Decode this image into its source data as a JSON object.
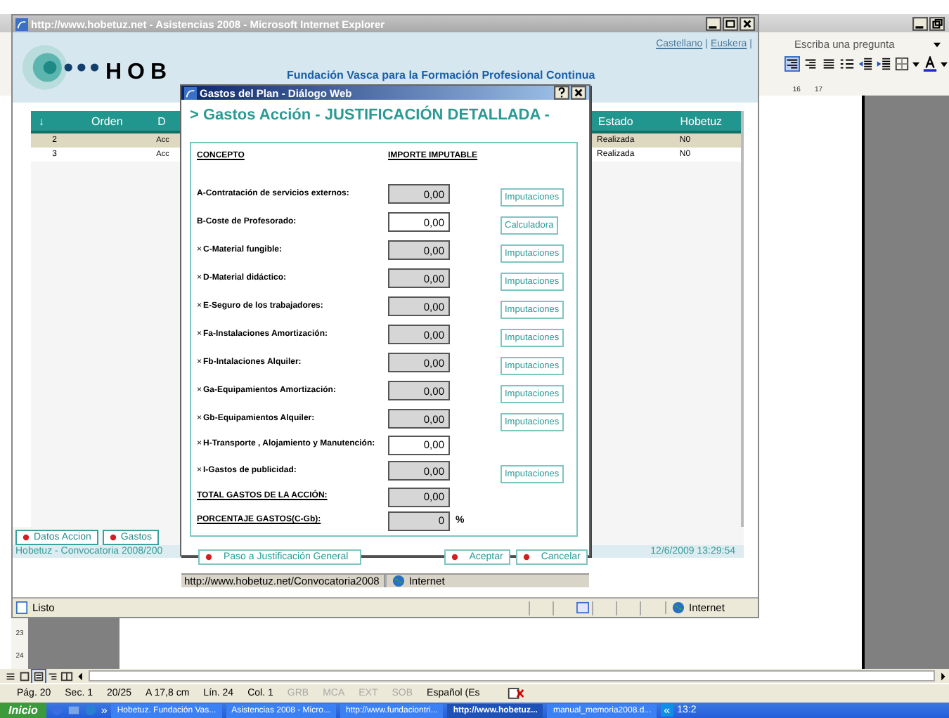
{
  "word": {
    "help_placeholder": "Escriba una pregunta",
    "ruler_labels": [
      "16",
      "17"
    ],
    "vertical_ruler_labels": [
      "23",
      "24"
    ],
    "status_bar": [
      {
        "text": "Pág. 20",
        "disabled": false
      },
      {
        "text": "Sec. 1",
        "disabled": false
      },
      {
        "text": "20/25",
        "disabled": false
      },
      {
        "text": "A 17,8 cm",
        "disabled": false
      },
      {
        "text": "Lín. 24",
        "disabled": false
      },
      {
        "text": "Col. 1",
        "disabled": false
      },
      {
        "text": "GRB",
        "disabled": true
      },
      {
        "text": "MCA",
        "disabled": true
      },
      {
        "text": "EXT",
        "disabled": true
      },
      {
        "text": "SOB",
        "disabled": true
      },
      {
        "text": "Español (Es",
        "disabled": false
      }
    ]
  },
  "browser": {
    "title": "http://www.hobetuz.net - Asistencias 2008 - Microsoft Internet Explorer",
    "language_links": [
      "Castellano",
      "Euskera"
    ],
    "link_separator": "|",
    "logo_text": "HOB",
    "tagline": "Fundación Vasca para la Formación Profesional Continua",
    "table": {
      "sort_marker": "↓",
      "columns": [
        "Orden",
        "D",
        "Estado",
        "Hobetuz"
      ],
      "rows": [
        {
          "cells": [
            "2",
            "Acc",
            "Realizada",
            "N0"
          ],
          "selected": true
        },
        {
          "cells": [
            "3",
            "Acc",
            "Realizada",
            "N0"
          ],
          "selected": false
        }
      ]
    },
    "bottom_tabs": [
      "Datos Accion",
      "Gastos"
    ],
    "footer_left": "Hobetuz - Convocatoria 2008/200",
    "footer_right": "12/6/2009 13:29:54",
    "status_text": "Listo",
    "zone": "Internet"
  },
  "dialog": {
    "title": "Gastos del Plan - Diálogo Web",
    "heading": "> Gastos Acción - JUSTIFICACIÓN DETALLADA -",
    "column_concept": "CONCEPTO",
    "column_amount": "IMPORTE IMPUTABLE",
    "rows": [
      {
        "kind": "item",
        "label": "A-Contratación de servicios externos:",
        "value": "0,00",
        "editable": false,
        "action": "Imputaciones"
      },
      {
        "kind": "item",
        "label": "B-Coste de Profesorado:",
        "value": "0,00",
        "editable": true,
        "action": "Calculadora"
      },
      {
        "kind": "item",
        "marker": "×",
        "label": "C-Material fungible:",
        "value": "0,00",
        "editable": false,
        "action": "Imputaciones"
      },
      {
        "kind": "item",
        "marker": "×",
        "label": "D-Material didáctico:",
        "value": "0,00",
        "editable": false,
        "action": "Imputaciones"
      },
      {
        "kind": "item",
        "marker": "×",
        "label": "E-Seguro de los trabajadores:",
        "value": "0,00",
        "editable": false,
        "action": "Imputaciones"
      },
      {
        "kind": "item",
        "marker": "×",
        "label": "Fa-Instalaciones Amortización:",
        "value": "0,00",
        "editable": false,
        "action": "Imputaciones"
      },
      {
        "kind": "item",
        "marker": "×",
        "label": "Fb-Intalaciones Alquiler:",
        "value": "0,00",
        "editable": false,
        "action": "Imputaciones"
      },
      {
        "kind": "item",
        "marker": "×",
        "label": "Ga-Equipamientos Amortización:",
        "value": "0,00",
        "editable": false,
        "action": "Imputaciones"
      },
      {
        "kind": "item",
        "marker": "×",
        "label": "Gb-Equipamientos Alquiler:",
        "value": "0,00",
        "editable": false,
        "action": "Imputaciones"
      },
      {
        "kind": "item",
        "marker": "×",
        "label": "H-Transporte , Alojamiento y Manutención:",
        "value": "0,00",
        "editable": true
      },
      {
        "kind": "item",
        "marker": "×",
        "label": "I-Gastos de publicidad:",
        "value": "0,00",
        "editable": false,
        "action": "Imputaciones"
      },
      {
        "kind": "total",
        "label": "TOTAL GASTOS DE LA ACCIÓN:",
        "value": "0,00",
        "editable": false
      },
      {
        "kind": "total",
        "label": "PORCENTAJE GASTOS(C-Gb):",
        "value": "0",
        "editable": false,
        "suffix": "%"
      }
    ],
    "buttons": [
      "Paso a Justificación General",
      "Aceptar",
      "Cancelar"
    ],
    "status_url": "http://www.hobetuz.net/Convocatoria2008",
    "zone": "Internet"
  },
  "taskbar": {
    "start": "Inicio",
    "more": "»",
    "buttons": [
      {
        "label": "Hobetuz. Fundación Vas...",
        "selected": false
      },
      {
        "label": "Asistencias 2008 - Micro...",
        "selected": false
      },
      {
        "label": "http://www.fundaciontri...",
        "selected": false
      },
      {
        "label": "http://www.hobetuz...",
        "selected": true
      },
      {
        "label": "manual_memoria2008.d...",
        "selected": false
      }
    ],
    "tray_toggle": "«",
    "clock": "13:2"
  }
}
